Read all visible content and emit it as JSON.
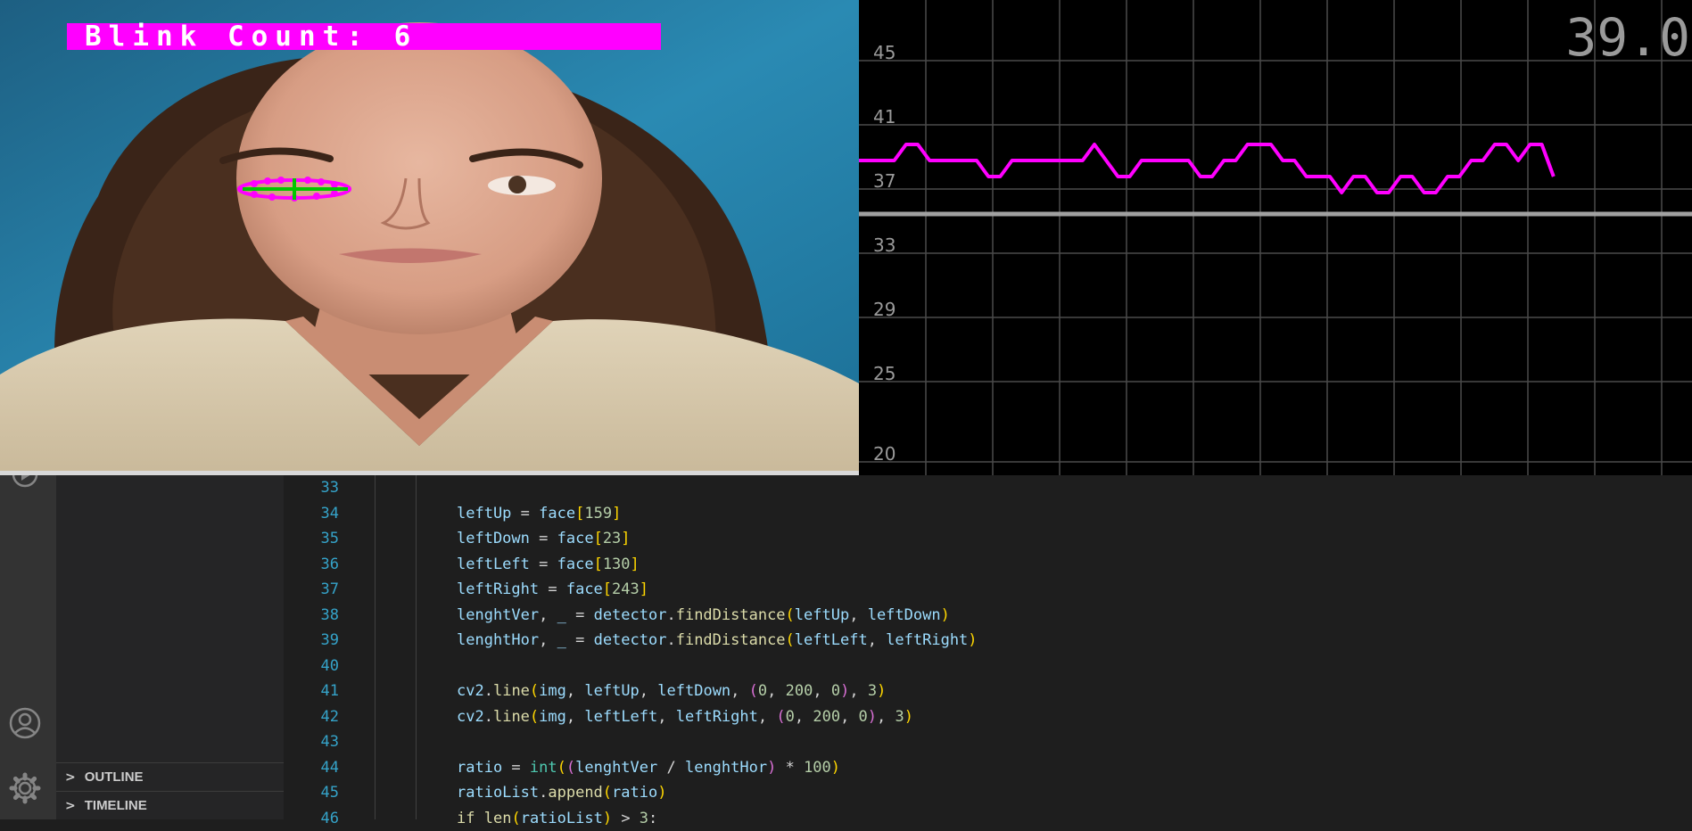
{
  "face_window": {
    "blink_label": "Blink Count: 6",
    "banner_color": "#ff00ff",
    "overlay_line_color": "#00c800",
    "landmark_color": "#ff00ff"
  },
  "plot": {
    "live_value": "39.0",
    "line_color": "#ff00ff",
    "threshold_color": "#a0a0a0",
    "y_tick_labels": [
      "45",
      "41",
      "37",
      "33",
      "29",
      "25",
      "20"
    ]
  },
  "chart_data": {
    "type": "line",
    "title": "",
    "xlabel": "",
    "ylabel": "",
    "ylim": [
      20,
      47
    ],
    "grid": true,
    "y_ticks": [
      45,
      41,
      37,
      33,
      29,
      25,
      20
    ],
    "threshold": 35,
    "series": [
      {
        "values": [
          39,
          39,
          39,
          39,
          40,
          40,
          39,
          39,
          39,
          39,
          39,
          38,
          38,
          39,
          39,
          39,
          39,
          39,
          39,
          39,
          40,
          39,
          38,
          38,
          39,
          39,
          39,
          39,
          39,
          38,
          38,
          39,
          39,
          40,
          40,
          40,
          39,
          39,
          38,
          38,
          38,
          37,
          38,
          38,
          37,
          37,
          38,
          38,
          37,
          37,
          38,
          38,
          39,
          39,
          40,
          40,
          39,
          40,
          40,
          38
        ]
      }
    ]
  },
  "sidebar": {
    "sections": [
      {
        "label": "OUTLINE",
        "chevron": ">"
      },
      {
        "label": "TIMELINE",
        "chevron": ">"
      }
    ]
  },
  "activity_bar": {
    "icons": [
      "run-debug-icon",
      "account-icon",
      "settings-gear-icon"
    ]
  },
  "editor": {
    "lines": [
      {
        "num": "33",
        "indent": 0,
        "tokens": []
      },
      {
        "num": "34",
        "indent": 1,
        "tokens": [
          [
            "var",
            "leftUp"
          ],
          [
            "op",
            " = "
          ],
          [
            "var",
            "face"
          ],
          [
            "b1",
            "["
          ],
          [
            "num",
            "159"
          ],
          [
            "b1",
            "]"
          ]
        ]
      },
      {
        "num": "35",
        "indent": 1,
        "tokens": [
          [
            "var",
            "leftDown"
          ],
          [
            "op",
            " = "
          ],
          [
            "var",
            "face"
          ],
          [
            "b1",
            "["
          ],
          [
            "num",
            "23"
          ],
          [
            "b1",
            "]"
          ]
        ]
      },
      {
        "num": "36",
        "indent": 1,
        "tokens": [
          [
            "var",
            "leftLeft"
          ],
          [
            "op",
            " = "
          ],
          [
            "var",
            "face"
          ],
          [
            "b1",
            "["
          ],
          [
            "num",
            "130"
          ],
          [
            "b1",
            "]"
          ]
        ]
      },
      {
        "num": "37",
        "indent": 1,
        "tokens": [
          [
            "var",
            "leftRight"
          ],
          [
            "op",
            " = "
          ],
          [
            "var",
            "face"
          ],
          [
            "b1",
            "["
          ],
          [
            "num",
            "243"
          ],
          [
            "b1",
            "]"
          ]
        ]
      },
      {
        "num": "38",
        "indent": 1,
        "tokens": [
          [
            "var",
            "lenghtVer"
          ],
          [
            "op",
            ", "
          ],
          [
            "var",
            "_"
          ],
          [
            "op",
            " = "
          ],
          [
            "var",
            "detector"
          ],
          [
            "op",
            "."
          ],
          [
            "fn",
            "findDistance"
          ],
          [
            "b1",
            "("
          ],
          [
            "var",
            "leftUp"
          ],
          [
            "op",
            ", "
          ],
          [
            "var",
            "leftDown"
          ],
          [
            "b1",
            ")"
          ]
        ]
      },
      {
        "num": "39",
        "indent": 1,
        "tokens": [
          [
            "var",
            "lenghtHor"
          ],
          [
            "op",
            ", "
          ],
          [
            "var",
            "_"
          ],
          [
            "op",
            " = "
          ],
          [
            "var",
            "detector"
          ],
          [
            "op",
            "."
          ],
          [
            "fn",
            "findDistance"
          ],
          [
            "b1",
            "("
          ],
          [
            "var",
            "leftLeft"
          ],
          [
            "op",
            ", "
          ],
          [
            "var",
            "leftRight"
          ],
          [
            "b1",
            ")"
          ]
        ]
      },
      {
        "num": "40",
        "indent": 0,
        "tokens": []
      },
      {
        "num": "41",
        "indent": 1,
        "tokens": [
          [
            "var",
            "cv2"
          ],
          [
            "op",
            "."
          ],
          [
            "fn",
            "line"
          ],
          [
            "b1",
            "("
          ],
          [
            "var",
            "img"
          ],
          [
            "op",
            ", "
          ],
          [
            "var",
            "leftUp"
          ],
          [
            "op",
            ", "
          ],
          [
            "var",
            "leftDown"
          ],
          [
            "op",
            ", "
          ],
          [
            "b2",
            "("
          ],
          [
            "num",
            "0"
          ],
          [
            "op",
            ", "
          ],
          [
            "num",
            "200"
          ],
          [
            "op",
            ", "
          ],
          [
            "num",
            "0"
          ],
          [
            "b2",
            ")"
          ],
          [
            "op",
            ", "
          ],
          [
            "num",
            "3"
          ],
          [
            "b1",
            ")"
          ]
        ]
      },
      {
        "num": "42",
        "indent": 1,
        "tokens": [
          [
            "var",
            "cv2"
          ],
          [
            "op",
            "."
          ],
          [
            "fn",
            "line"
          ],
          [
            "b1",
            "("
          ],
          [
            "var",
            "img"
          ],
          [
            "op",
            ", "
          ],
          [
            "var",
            "leftLeft"
          ],
          [
            "op",
            ", "
          ],
          [
            "var",
            "leftRight"
          ],
          [
            "op",
            ", "
          ],
          [
            "b2",
            "("
          ],
          [
            "num",
            "0"
          ],
          [
            "op",
            ", "
          ],
          [
            "num",
            "200"
          ],
          [
            "op",
            ", "
          ],
          [
            "num",
            "0"
          ],
          [
            "b2",
            ")"
          ],
          [
            "op",
            ", "
          ],
          [
            "num",
            "3"
          ],
          [
            "b1",
            ")"
          ]
        ]
      },
      {
        "num": "43",
        "indent": 0,
        "tokens": []
      },
      {
        "num": "44",
        "indent": 1,
        "tokens": [
          [
            "var",
            "ratio"
          ],
          [
            "op",
            " = "
          ],
          [
            "cls",
            "int"
          ],
          [
            "b1",
            "("
          ],
          [
            "b2",
            "("
          ],
          [
            "var",
            "lenghtVer"
          ],
          [
            "op",
            " / "
          ],
          [
            "var",
            "lenghtHor"
          ],
          [
            "b2",
            ")"
          ],
          [
            "op",
            " * "
          ],
          [
            "num",
            "100"
          ],
          [
            "b1",
            ")"
          ]
        ]
      },
      {
        "num": "45",
        "indent": 1,
        "tokens": [
          [
            "var",
            "ratioList"
          ],
          [
            "op",
            "."
          ],
          [
            "fn",
            "append"
          ],
          [
            "b1",
            "("
          ],
          [
            "var",
            "ratio"
          ],
          [
            "b1",
            ")"
          ]
        ]
      },
      {
        "num": "46",
        "indent": 1,
        "tokens": [
          [
            "fn",
            "if"
          ],
          [
            "op",
            " "
          ],
          [
            "fn",
            "len"
          ],
          [
            "b1",
            "("
          ],
          [
            "var",
            "ratioList"
          ],
          [
            "b1",
            ")"
          ],
          [
            "op",
            " > "
          ],
          [
            "num",
            "3"
          ],
          [
            "op",
            ":"
          ]
        ]
      }
    ]
  }
}
